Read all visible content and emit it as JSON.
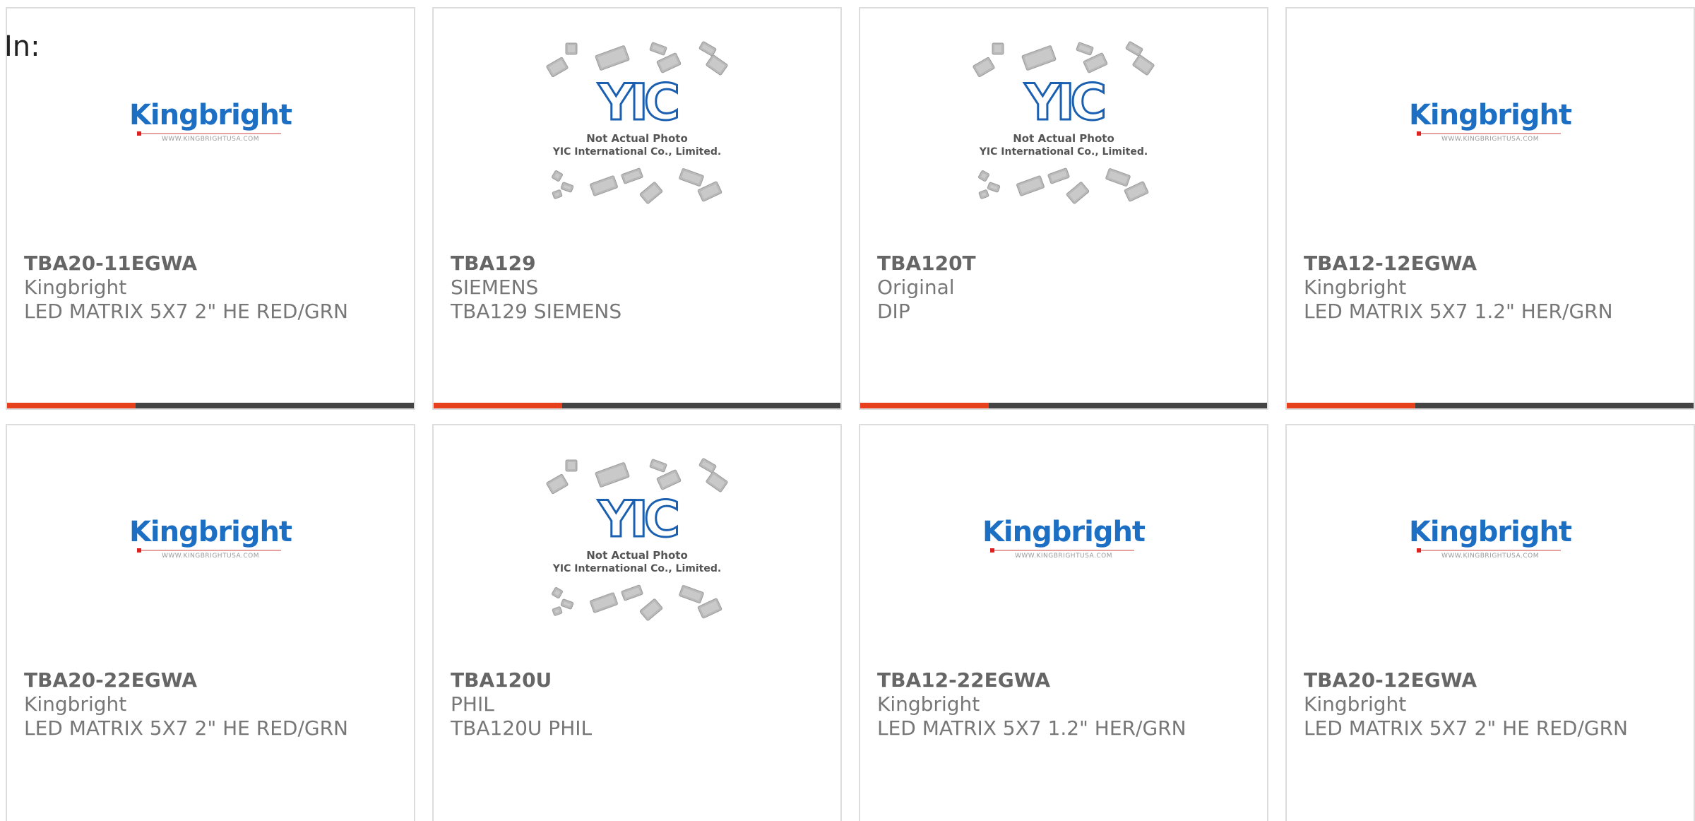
{
  "filter": {
    "label": "In:"
  },
  "logos": {
    "kingbright": {
      "name": "Kingbright",
      "url": "WWW.KINGBRIGHTUSA.COM"
    },
    "yic": {
      "mark": "YIC",
      "line1": "Not Actual Photo",
      "line2": "YIC International Co., Limited."
    }
  },
  "colors": {
    "accent": "#e8401c",
    "bar": "#444444",
    "kingbright_blue": "#1d6fc4",
    "yic_blue": "#1a5fb0"
  },
  "products": [
    {
      "part": "TBA20-11EGWA",
      "maker": "Kingbright",
      "desc": "LED MATRIX 5X7 2\" HE RED/GRN",
      "image": "kingbright-logo"
    },
    {
      "part": "TBA129",
      "maker": "SIEMENS",
      "desc": "TBA129 SIEMENS",
      "image": "yic-placeholder"
    },
    {
      "part": "TBA120T",
      "maker": "Original",
      "desc": "DIP",
      "image": "yic-placeholder"
    },
    {
      "part": "TBA12-12EGWA",
      "maker": "Kingbright",
      "desc": "LED MATRIX 5X7 1.2\" HER/GRN",
      "image": "kingbright-logo"
    },
    {
      "part": "TBA20-22EGWA",
      "maker": "Kingbright",
      "desc": "LED MATRIX 5X7 2\" HE RED/GRN",
      "image": "kingbright-logo"
    },
    {
      "part": "TBA120U",
      "maker": "PHIL",
      "desc": "TBA120U PHIL",
      "image": "yic-placeholder"
    },
    {
      "part": "TBA12-22EGWA",
      "maker": "Kingbright",
      "desc": "LED MATRIX 5X7 1.2\" HER/GRN",
      "image": "kingbright-logo"
    },
    {
      "part": "TBA20-12EGWA",
      "maker": "Kingbright",
      "desc": "LED MATRIX 5X7 2\" HE RED/GRN",
      "image": "kingbright-logo"
    }
  ]
}
